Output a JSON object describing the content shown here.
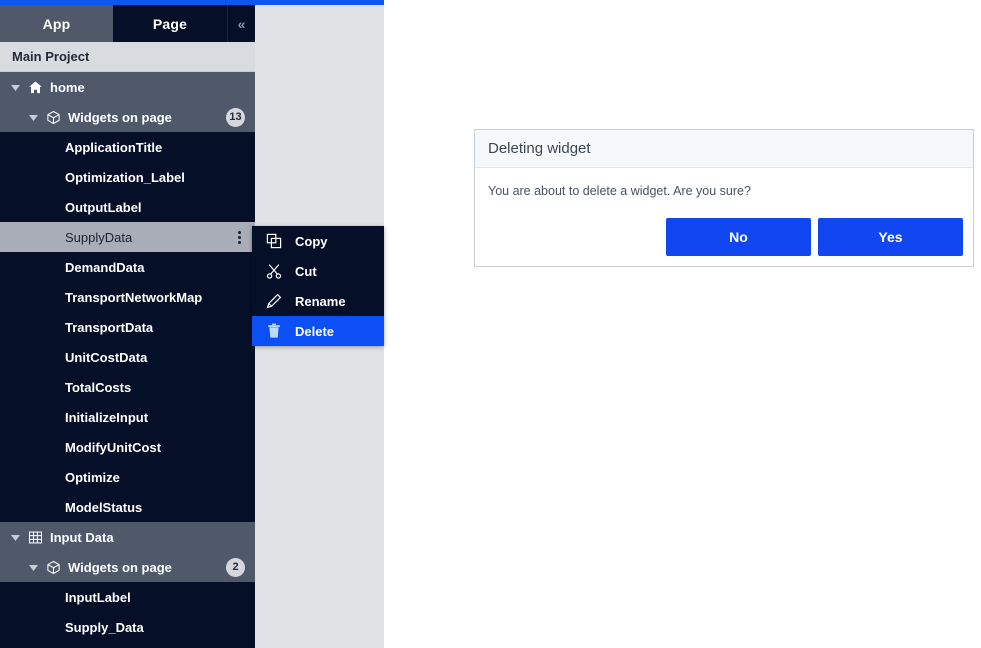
{
  "window": {
    "accent_blue": "#0b57f0",
    "panel_dark": "#050f28",
    "panel_slate": "#4f596a"
  },
  "tabs": {
    "app_label": "App",
    "page_label": "Page",
    "collapse_label": "«"
  },
  "project": {
    "name": "Main Project"
  },
  "tree": {
    "items": [
      {
        "label": "home",
        "level": 0,
        "icon": "home-icon",
        "type": "group",
        "twisty": "down"
      },
      {
        "label": "Widgets on page",
        "level": 1,
        "icon": "widget-icon",
        "type": "group",
        "twisty": "down",
        "badge": "13"
      },
      {
        "label": "ApplicationTitle",
        "level": 2,
        "type": "leaf"
      },
      {
        "label": "Optimization_Label",
        "level": 2,
        "type": "leaf"
      },
      {
        "label": "OutputLabel",
        "level": 2,
        "type": "leaf"
      },
      {
        "label": "SupplyData",
        "level": 2,
        "type": "leaf",
        "selected": true,
        "kebab": true
      },
      {
        "label": "DemandData",
        "level": 2,
        "type": "leaf"
      },
      {
        "label": "TransportNetworkMap",
        "level": 2,
        "type": "leaf"
      },
      {
        "label": "TransportData",
        "level": 2,
        "type": "leaf"
      },
      {
        "label": "UnitCostData",
        "level": 2,
        "type": "leaf"
      },
      {
        "label": "TotalCosts",
        "level": 2,
        "type": "leaf"
      },
      {
        "label": "InitializeInput",
        "level": 2,
        "type": "leaf"
      },
      {
        "label": "ModifyUnitCost",
        "level": 2,
        "type": "leaf"
      },
      {
        "label": "Optimize",
        "level": 2,
        "type": "leaf"
      },
      {
        "label": "ModelStatus",
        "level": 2,
        "type": "leaf"
      },
      {
        "label": "Input Data",
        "level": 0,
        "icon": "table-icon",
        "type": "group",
        "twisty": "down"
      },
      {
        "label": "Widgets on page",
        "level": 1,
        "icon": "widget-icon",
        "type": "group",
        "twisty": "down",
        "badge": "2"
      },
      {
        "label": "InputLabel",
        "level": 2,
        "type": "leaf"
      },
      {
        "label": "Supply_Data",
        "level": 2,
        "type": "leaf"
      }
    ]
  },
  "context_menu": {
    "items": [
      {
        "label": "Copy",
        "icon": "copy-icon",
        "active": false
      },
      {
        "label": "Cut",
        "icon": "scissors-icon",
        "active": false
      },
      {
        "label": "Rename",
        "icon": "pencil-icon",
        "active": false
      },
      {
        "label": "Delete",
        "icon": "trash-icon",
        "active": true
      }
    ],
    "highlight_color": "#0b4ff5"
  },
  "dialog": {
    "title": "Deleting widget",
    "message": "You are about to delete a widget. Are you sure?",
    "no_label": "No",
    "yes_label": "Yes",
    "button_color": "#1147f0"
  }
}
